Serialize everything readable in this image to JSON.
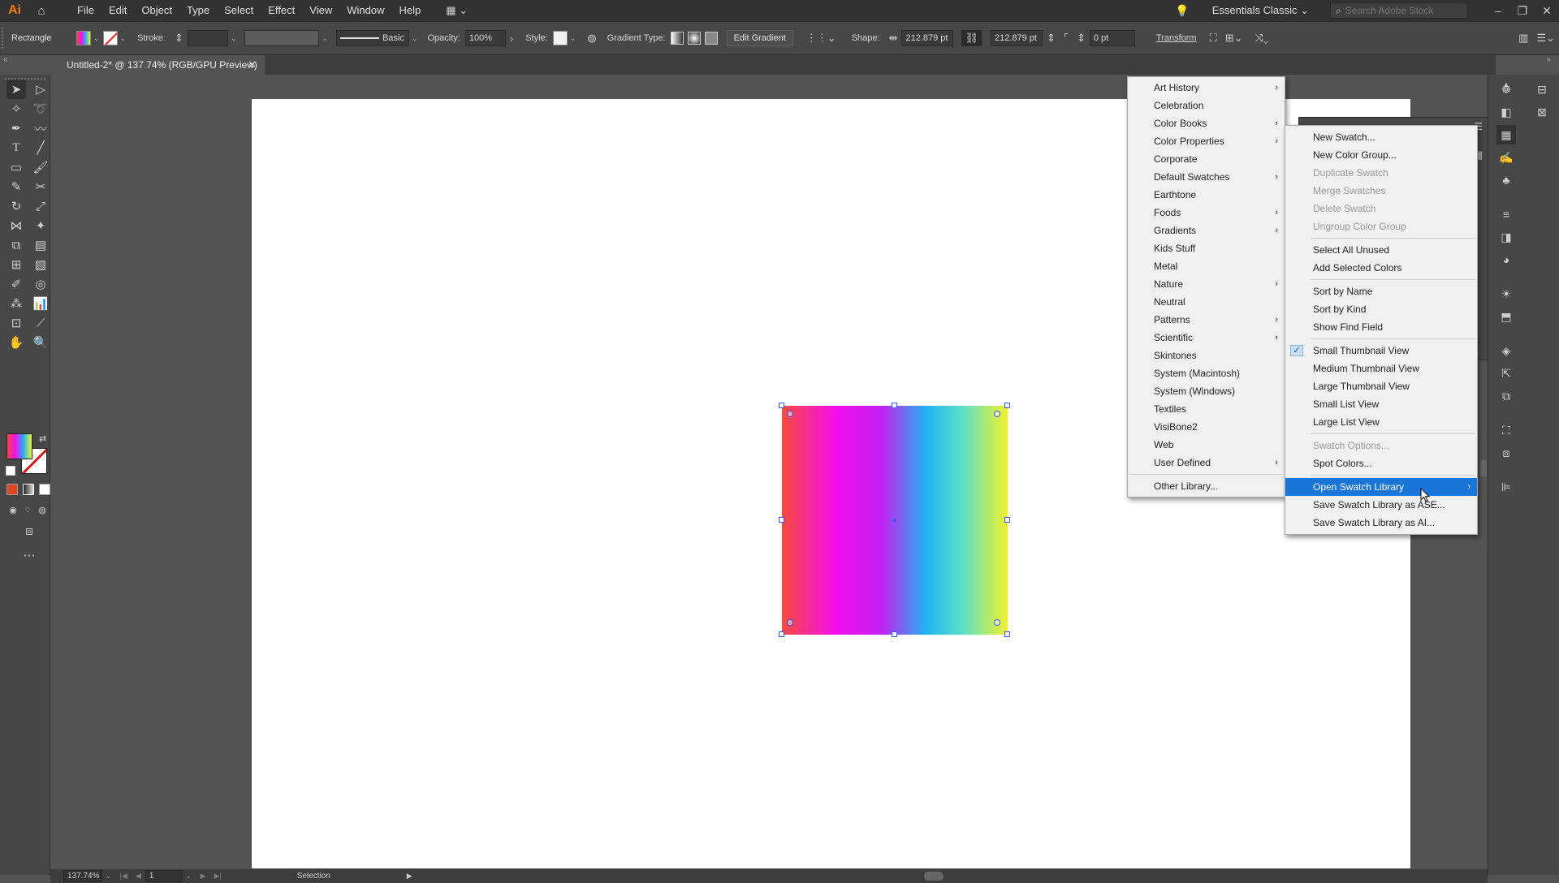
{
  "app": {
    "logo": "Ai",
    "menus": [
      "File",
      "Edit",
      "Object",
      "Type",
      "Select",
      "Effect",
      "View",
      "Window",
      "Help"
    ],
    "workspace": "Essentials Classic",
    "search_placeholder": "Search Adobe Stock"
  },
  "control_bar": {
    "selection_type": "Rectangle",
    "stroke_label": "Stroke:",
    "brush_label": "Basic",
    "opacity_label": "Opacity:",
    "opacity_value": "100%",
    "style_label": "Style:",
    "gradient_type_label": "Gradient Type:",
    "edit_gradient": "Edit Gradient",
    "shape_label": "Shape:",
    "width_value": "212.879 pt",
    "height_value": "212.879 pt",
    "corner_value": "0 pt",
    "transform_label": "Transform"
  },
  "document": {
    "tab_title": "Untitled-2* @ 137.74% (RGB/GPU Preview)"
  },
  "library_menu": {
    "items": [
      {
        "label": "Art History",
        "submenu": true
      },
      {
        "label": "Celebration",
        "submenu": false
      },
      {
        "label": "Color Books",
        "submenu": true
      },
      {
        "label": "Color Properties",
        "submenu": true
      },
      {
        "label": "Corporate",
        "submenu": false
      },
      {
        "label": "Default Swatches",
        "submenu": true
      },
      {
        "label": "Earthtone",
        "submenu": false
      },
      {
        "label": "Foods",
        "submenu": true
      },
      {
        "label": "Gradients",
        "submenu": true
      },
      {
        "label": "Kids Stuff",
        "submenu": false
      },
      {
        "label": "Metal",
        "submenu": false
      },
      {
        "label": "Nature",
        "submenu": true
      },
      {
        "label": "Neutral",
        "submenu": false
      },
      {
        "label": "Patterns",
        "submenu": true
      },
      {
        "label": "Scientific",
        "submenu": true
      },
      {
        "label": "Skintones",
        "submenu": false
      },
      {
        "label": "System (Macintosh)",
        "submenu": false
      },
      {
        "label": "System (Windows)",
        "submenu": false
      },
      {
        "label": "Textiles",
        "submenu": false
      },
      {
        "label": "VisiBone2",
        "submenu": false
      },
      {
        "label": "Web",
        "submenu": false
      },
      {
        "label": "User Defined",
        "submenu": true
      }
    ],
    "other": "Other Library..."
  },
  "swatches_menu": {
    "groups": [
      [
        {
          "label": "New Swatch...",
          "disabled": false
        },
        {
          "label": "New Color Group...",
          "disabled": false
        },
        {
          "label": "Duplicate Swatch",
          "disabled": true
        },
        {
          "label": "Merge Swatches",
          "disabled": true
        },
        {
          "label": "Delete Swatch",
          "disabled": true
        },
        {
          "label": "Ungroup Color Group",
          "disabled": true
        }
      ],
      [
        {
          "label": "Select All Unused",
          "disabled": false
        },
        {
          "label": "Add Selected Colors",
          "disabled": false
        }
      ],
      [
        {
          "label": "Sort by Name",
          "disabled": false
        },
        {
          "label": "Sort by Kind",
          "disabled": false
        },
        {
          "label": "Show Find Field",
          "disabled": false
        }
      ],
      [
        {
          "label": "Small Thumbnail View",
          "disabled": false,
          "checked": true
        },
        {
          "label": "Medium Thumbnail View",
          "disabled": false
        },
        {
          "label": "Large Thumbnail View",
          "disabled": false
        },
        {
          "label": "Small List View",
          "disabled": false
        },
        {
          "label": "Large List View",
          "disabled": false
        }
      ],
      [
        {
          "label": "Swatch Options...",
          "disabled": true
        },
        {
          "label": "Spot Colors...",
          "disabled": false
        }
      ],
      [
        {
          "label": "Open Swatch Library",
          "disabled": false,
          "submenu": true,
          "highlight": true
        },
        {
          "label": "Save Swatch Library as ASE...",
          "disabled": false
        },
        {
          "label": "Save Swatch Library as AI...",
          "disabled": false
        }
      ]
    ]
  },
  "status_bar": {
    "zoom": "137.74%",
    "page": "1",
    "status": "Selection"
  },
  "colors": {
    "accent": "#1975d8",
    "gradient": [
      "#f84a3d",
      "#f20df0",
      "#22b4f3",
      "#f2f12d"
    ]
  }
}
